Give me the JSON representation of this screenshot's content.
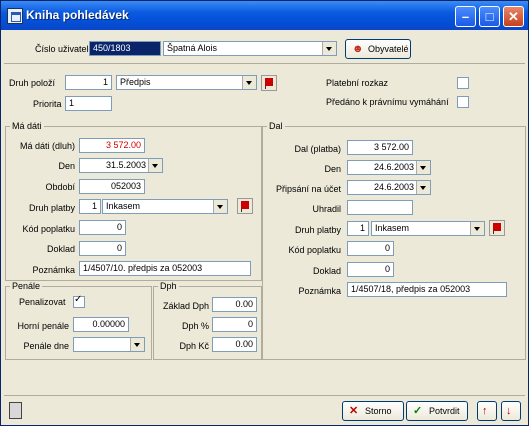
{
  "window": {
    "title": "Kniha pohledávek"
  },
  "header": {
    "cislo_label": "Číslo uživatele",
    "cislo_value": "450/1803",
    "uzivatel_value": "Špatná Alois",
    "obyvatele_label": "Obyvatelé"
  },
  "top": {
    "druh_label": "Druh položí",
    "druh_num": "1",
    "druh_value": "Předpis",
    "priorita_label": "Priorita",
    "priorita_value": "1",
    "platebni_label": "Platební rozkaz",
    "predano_label": "Předáno k právnímu vymáhání"
  },
  "madati": {
    "title": "Má dáti",
    "rows": {
      "madati_label": "Má dáti (dluh)",
      "madati_value": "3 572.00",
      "den_label": "Den",
      "den_value": "31.5.2003",
      "obdobi_label": "Období",
      "obdobi_value": "052003",
      "druh_label": "Druh platby",
      "druh_num": "1",
      "druh_value": "Inkasem",
      "kod_label": "Kód poplatku",
      "kod_value": "0",
      "doklad_label": "Doklad",
      "doklad_value": "0",
      "poznamka_label": "Poznámka",
      "poznamka_value": "1/4507/10. předpis za 052003"
    }
  },
  "dal": {
    "title": "Dal",
    "rows": {
      "dal_label": "Dal (platba)",
      "dal_value": "3 572.00",
      "den_label": "Den",
      "den_value": "24.6.2003",
      "pripsani_label": "Připsání na účet",
      "pripsani_value": "24.6.2003",
      "uhradil_label": "Uhradil",
      "uhradil_value": "",
      "druh_label": "Druh platby",
      "druh_num": "1",
      "druh_value": "Inkasem",
      "kod_label": "Kód poplatku",
      "kod_value": "0",
      "doklad_label": "Doklad",
      "doklad_value": "0",
      "poznamka_label": "Poznámka",
      "poznamka_value": "1/4507/18, předpis za 052003"
    }
  },
  "penale": {
    "title": "Penále",
    "penalizovat_label": "Penalizovat",
    "horni_label": "Horní penále",
    "horni_value": "0.00000",
    "druh_label": "Penále dne",
    "druh_value": ""
  },
  "dph": {
    "title": "Dph",
    "zaklad_label": "Základ Dph",
    "zaklad_value": "0.00",
    "pct_label": "Dph %",
    "pct_value": "0",
    "kc_label": "Dph Kč",
    "kc_value": "0.00"
  },
  "footer": {
    "storno_label": "Storno",
    "potvrdit_label": "Potvrdit"
  },
  "colors": {
    "title_bar": "#0a5ae0",
    "amount_red": "#d00000",
    "selection": "#0a246a"
  }
}
